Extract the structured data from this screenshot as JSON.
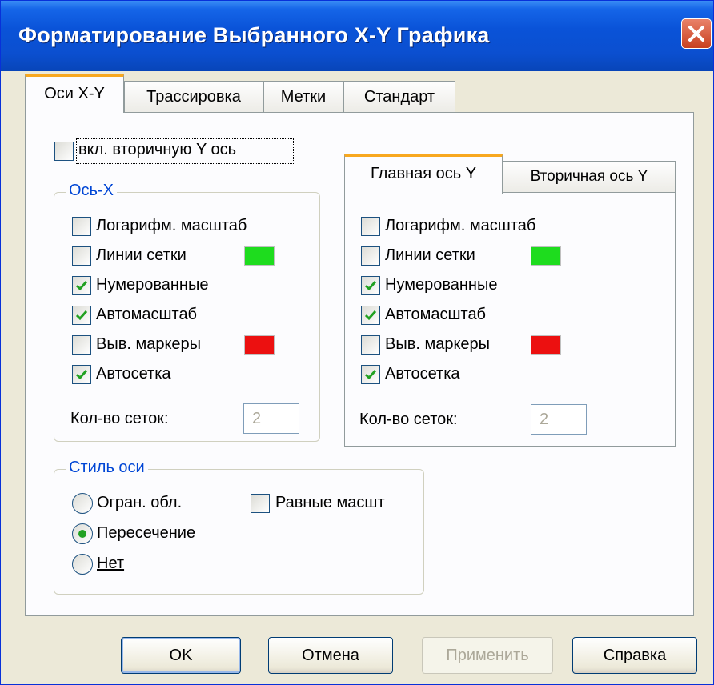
{
  "dialog": {
    "title": "Форматирование Выбранного X-Y Графика"
  },
  "tabs": [
    "Оси X-Y",
    "Трассировка",
    "Метки",
    "Стандарт"
  ],
  "secondary_y_checkbox": {
    "label": "вкл. вторичную Y ось",
    "checked": false
  },
  "x_axis": {
    "group_title": "Ось-X",
    "options": [
      {
        "label": "Логарифм. масштаб",
        "checked": false
      },
      {
        "label": "Линии сетки",
        "checked": false,
        "color": "#1edc1e"
      },
      {
        "label": "Нумерованные",
        "checked": true
      },
      {
        "label": "Автомасштаб",
        "checked": true
      },
      {
        "label": "Выв. маркеры",
        "checked": false,
        "color": "#ec1010"
      },
      {
        "label": "Автосетка",
        "checked": true
      }
    ],
    "grid_count_label": "Кол-во сеток:",
    "grid_count_value": "2"
  },
  "y_axis": {
    "tabs": [
      "Главная ось Y",
      "Вторичная ось Y"
    ],
    "options": [
      {
        "label": "Логарифм. масштаб",
        "checked": false
      },
      {
        "label": "Линии сетки",
        "checked": false,
        "color": "#1edc1e"
      },
      {
        "label": "Нумерованные",
        "checked": true
      },
      {
        "label": "Автомасштаб",
        "checked": true
      },
      {
        "label": "Выв. маркеры",
        "checked": false,
        "color": "#ec1010"
      },
      {
        "label": "Автосетка",
        "checked": true
      }
    ],
    "grid_count_label": "Кол-во сеток:",
    "grid_count_value": "2"
  },
  "axis_style": {
    "group_title": "Стиль оси",
    "radios": [
      {
        "label": "Огран. обл.",
        "selected": false
      },
      {
        "label": "Пересечение",
        "selected": true
      },
      {
        "label": "Нет",
        "selected": false
      }
    ],
    "equal_scale": {
      "label": "Равные масшт",
      "checked": false
    }
  },
  "buttons": {
    "ok": "OK",
    "cancel": "Отмена",
    "apply": "Применить",
    "help": "Справка"
  }
}
